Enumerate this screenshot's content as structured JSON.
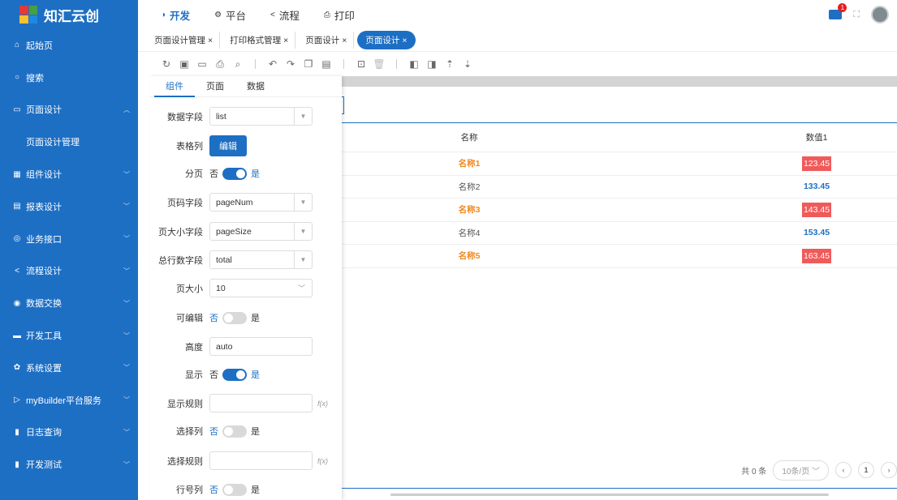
{
  "brand": {
    "name": "知汇云创"
  },
  "sidebar": {
    "items": [
      {
        "label": "起始页",
        "icon": "home-icon",
        "glyph": "⌂"
      },
      {
        "label": "搜索",
        "icon": "search-icon",
        "glyph": "○"
      },
      {
        "label": "页面设计",
        "icon": "monitor-icon",
        "glyph": "▭",
        "chev": "︿"
      },
      {
        "label": "页面设计管理",
        "sub": true
      },
      {
        "label": "组件设计",
        "icon": "grid-icon",
        "glyph": "▦",
        "chev": "﹀"
      },
      {
        "label": "报表设计",
        "icon": "clipboard-icon",
        "glyph": "▤",
        "chev": "﹀"
      },
      {
        "label": "业务接口",
        "icon": "settings-icon",
        "glyph": "◎",
        "chev": "﹀"
      },
      {
        "label": "流程设计",
        "icon": "share-icon",
        "glyph": "<",
        "chev": "﹀"
      },
      {
        "label": "数据交换",
        "icon": "database-icon",
        "glyph": "◉",
        "chev": "﹀"
      },
      {
        "label": "开发工具",
        "icon": "toolbox-icon",
        "glyph": "▬",
        "chev": "﹀"
      },
      {
        "label": "系统设置",
        "icon": "gear-icon",
        "glyph": "✿",
        "chev": "﹀"
      },
      {
        "label": "myBuilder平台服务",
        "icon": "tag-icon",
        "glyph": "▷",
        "chev": "﹀"
      },
      {
        "label": "日志查询",
        "icon": "log-icon",
        "glyph": "▮",
        "chev": "﹀"
      },
      {
        "label": "开发测试",
        "icon": "test-icon",
        "glyph": "▮",
        "chev": "﹀"
      }
    ]
  },
  "topnav": {
    "tabs": [
      {
        "label": "开发",
        "glyph": "◑",
        "active": true
      },
      {
        "label": "平台",
        "glyph": "⚙"
      },
      {
        "label": "流程",
        "glyph": "<"
      },
      {
        "label": "打印",
        "glyph": "⎙"
      }
    ],
    "badge": "1"
  },
  "pagetabs": [
    {
      "label": "页面设计管理",
      "close": "×"
    },
    {
      "label": "打印格式管理",
      "close": "×"
    },
    {
      "label": "页面设计",
      "close": "×"
    },
    {
      "label": "页面设计",
      "close": "×",
      "active": true
    }
  ],
  "panel": {
    "tabs": [
      "组件",
      "页面",
      "数据"
    ],
    "fields": {
      "data_field": {
        "label": "数据字段",
        "value": "list"
      },
      "table_col": {
        "label": "表格列",
        "button": "编辑"
      },
      "paging": {
        "label": "分页",
        "no": "否",
        "yes": "是"
      },
      "page_num": {
        "label": "页码字段",
        "value": "pageNum"
      },
      "page_size_field": {
        "label": "页大小字段",
        "value": "pageSize"
      },
      "total_field": {
        "label": "总行数字段",
        "value": "total"
      },
      "page_size": {
        "label": "页大小",
        "value": "10"
      },
      "editable": {
        "label": "可编辑",
        "no": "否",
        "yes": "是"
      },
      "height": {
        "label": "高度",
        "value": "auto"
      },
      "visible": {
        "label": "显示",
        "no": "否",
        "yes": "是"
      },
      "show_rule": {
        "label": "显示规则",
        "fx": "f(x)"
      },
      "select_col": {
        "label": "选择列",
        "no": "否",
        "yes": "是"
      },
      "select_rule": {
        "label": "选择规则",
        "fx": "f(x)"
      },
      "rownum_col": {
        "label": "行号列",
        "no": "否",
        "yes": "是"
      }
    }
  },
  "table": {
    "headers": [
      "名称",
      "数值1"
    ],
    "rows": [
      {
        "name": "名称1",
        "value": "123.45"
      },
      {
        "name": "名称2",
        "value": "133.45"
      },
      {
        "name": "名称3",
        "value": "143.45"
      },
      {
        "name": "名称4",
        "value": "153.45"
      },
      {
        "name": "名称5",
        "value": "163.45"
      }
    ],
    "pager": {
      "total": "共 0 条",
      "size": "10条/页",
      "page": "1"
    }
  }
}
